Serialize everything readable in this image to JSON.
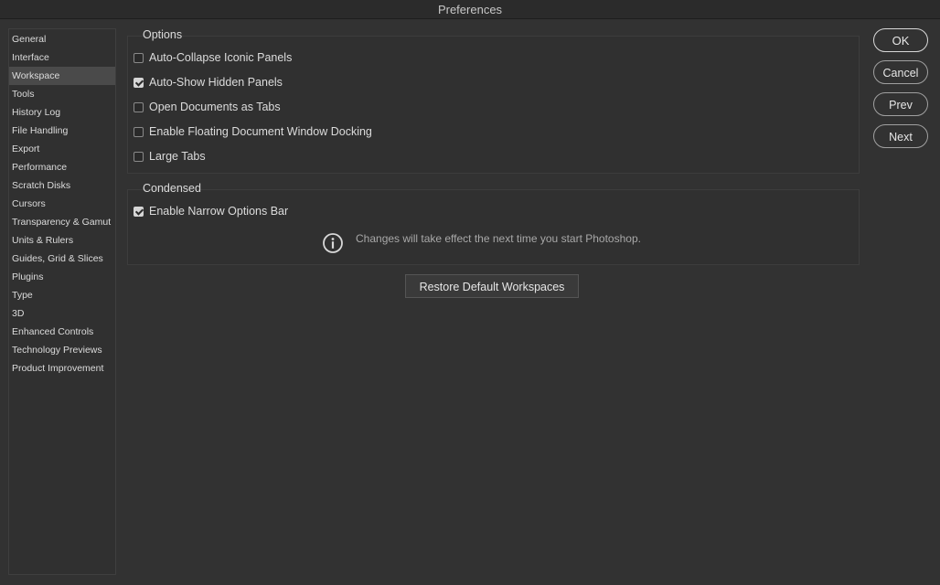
{
  "window": {
    "title": "Preferences"
  },
  "sidebar": {
    "items": [
      {
        "label": "General"
      },
      {
        "label": "Interface"
      },
      {
        "label": "Workspace"
      },
      {
        "label": "Tools"
      },
      {
        "label": "History Log"
      },
      {
        "label": "File Handling"
      },
      {
        "label": "Export"
      },
      {
        "label": "Performance"
      },
      {
        "label": "Scratch Disks"
      },
      {
        "label": "Cursors"
      },
      {
        "label": "Transparency & Gamut"
      },
      {
        "label": "Units & Rulers"
      },
      {
        "label": "Guides, Grid & Slices"
      },
      {
        "label": "Plugins"
      },
      {
        "label": "Type"
      },
      {
        "label": "3D"
      },
      {
        "label": "Enhanced Controls"
      },
      {
        "label": "Technology Previews"
      },
      {
        "label": "Product Improvement"
      }
    ],
    "selected": "Workspace"
  },
  "options": {
    "title": "Options",
    "items": [
      {
        "label": "Auto-Collapse Iconic Panels",
        "checked": false
      },
      {
        "label": "Auto-Show Hidden Panels",
        "checked": true
      },
      {
        "label": "Open Documents as Tabs",
        "checked": false
      },
      {
        "label": "Enable Floating Document Window Docking",
        "checked": false
      },
      {
        "label": "Large Tabs",
        "checked": false
      }
    ]
  },
  "condensed": {
    "title": "Condensed",
    "items": [
      {
        "label": "Enable Narrow Options Bar",
        "checked": true
      }
    ],
    "info": "Changes will take effect the next time you start Photoshop.",
    "info_icon": "info-icon"
  },
  "restore_button": "Restore Default Workspaces",
  "buttons": {
    "ok": "OK",
    "cancel": "Cancel",
    "prev": "Prev",
    "next": "Next"
  },
  "colors": {
    "background": "#323232",
    "panel": "#303030",
    "text": "#dcdcdc",
    "muted_text": "#a8a8a8",
    "selected_item": "#4a4a4a"
  }
}
